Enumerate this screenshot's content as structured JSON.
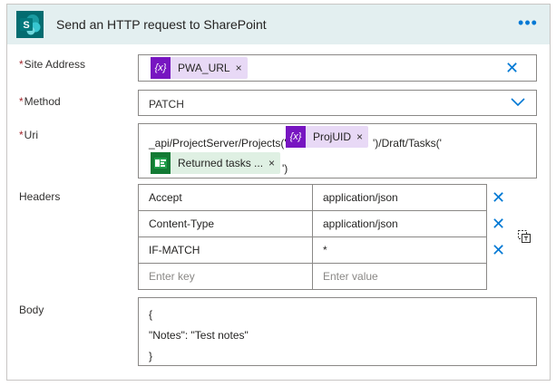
{
  "header": {
    "app_letter": "S",
    "title": "Send an HTTP request to SharePoint",
    "more_icon": "more-icon"
  },
  "site_address": {
    "label": "Site Address",
    "required": "*",
    "token_icon": "{x}",
    "token_label": "PWA_URL",
    "token_remove": "×"
  },
  "method": {
    "label": "Method",
    "required": "*",
    "value": "PATCH"
  },
  "uri": {
    "label": "Uri",
    "required": "*",
    "text_before": "_api/ProjectServer/Projects('",
    "token1_icon": "{x}",
    "token1_label": "ProjUID",
    "token1_remove": "×",
    "text_middle": "')/Draft/Tasks('",
    "token2_label": "Returned tasks ...",
    "token2_remove": "×",
    "text_after": "')"
  },
  "headers": {
    "label": "Headers",
    "rows": [
      {
        "key": "Accept",
        "value": "application/json"
      },
      {
        "key": "Content-Type",
        "value": "application/json"
      },
      {
        "key": "IF-MATCH",
        "value": "*"
      }
    ],
    "key_placeholder": "Enter key",
    "value_placeholder": "Enter value"
  },
  "body": {
    "label": "Body",
    "lines": [
      "{",
      "\"Notes\": \"Test notes\"",
      "}"
    ]
  },
  "colors": {
    "header_bg": "#e3eff0",
    "accent": "#0078d4",
    "sharepoint_teal": "#036c70",
    "variable_purple": "#7715c1",
    "project_green": "#137a34"
  }
}
